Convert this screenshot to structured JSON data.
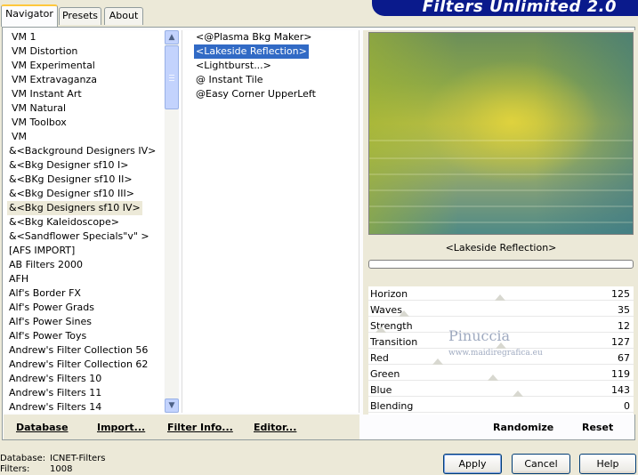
{
  "tabs": [
    "Navigator",
    "Presets",
    "About"
  ],
  "banner": "Filters Unlimited 2.0",
  "categories": [
    "VM 1",
    "VM Distortion",
    "VM Experimental",
    "VM Extravaganza",
    "VM Instant Art",
    "VM Natural",
    "VM Toolbox",
    "VM",
    "&<Background Designers IV>",
    "&<Bkg Designer sf10 I>",
    "&<BKg Designer sf10 II>",
    "&<Bkg Designer sf10 III>",
    "&<Bkg Designers sf10 IV>",
    "&<Bkg Kaleidoscope>",
    "&<Sandflower Specials\"v\" >",
    "[AFS IMPORT]",
    "AB Filters 2000",
    "AFH",
    "Alf's Border FX",
    "Alf's Power Grads",
    "Alf's Power Sines",
    "Alf's Power Toys",
    "Andrew's Filter Collection 56",
    "Andrew's Filter Collection 62",
    "Andrew's Filters 10",
    "Andrew's Filters 11",
    "Andrew's Filters 14"
  ],
  "selected_category": "&<Bkg Designers sf10 IV>",
  "filters": [
    "<@Plasma Bkg Maker>",
    "<Lakeside Reflection>",
    "<Lightburst...>",
    "@ Instant Tile",
    "@Easy Corner UpperLeft"
  ],
  "selected_filter": "<Lakeside Reflection>",
  "bottom_links": {
    "database": "Database",
    "import": "Import...",
    "filter_info": "Filter Info...",
    "editor": "Editor..."
  },
  "preview_title": "<Lakeside Reflection>",
  "watermark": {
    "name": "Pinuccia",
    "url": "www.maidiregrafica.eu"
  },
  "params": [
    {
      "name": "Horizon",
      "value": "125"
    },
    {
      "name": "Waves",
      "value": "35"
    },
    {
      "name": "Strength",
      "value": "12"
    },
    {
      "name": "Transition",
      "value": "127"
    },
    {
      "name": "Red",
      "value": "67"
    },
    {
      "name": "Green",
      "value": "119"
    },
    {
      "name": "Blue",
      "value": "143"
    },
    {
      "name": "Blending",
      "value": "0"
    }
  ],
  "actions": {
    "randomize": "Randomize",
    "reset": "Reset"
  },
  "footer": {
    "database_label": "Database:",
    "database_value": "ICNET-Filters",
    "filters_label": "Filters:",
    "filters_value": "1008"
  },
  "buttons": {
    "apply": "Apply",
    "cancel": "Cancel",
    "help": "Help"
  },
  "colors": {
    "banner": "#0a1a8c",
    "selection": "#316ac5",
    "tab_highlight": "#ffc83c"
  }
}
